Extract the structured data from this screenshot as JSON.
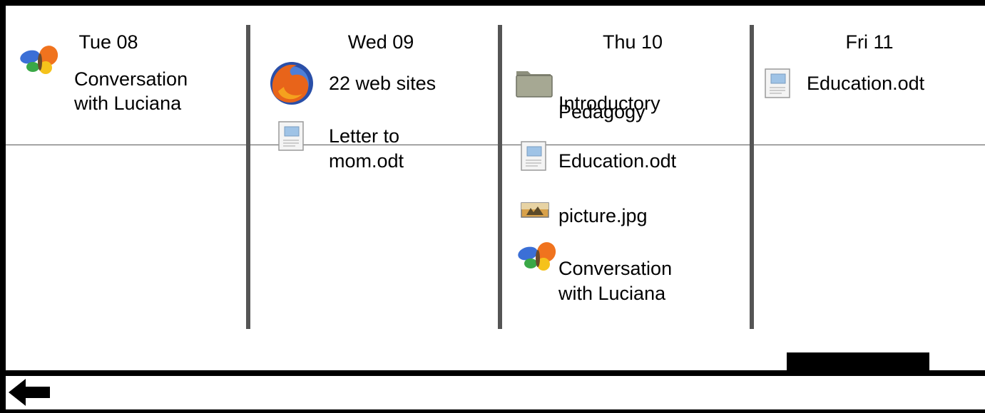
{
  "days": [
    {
      "header": "Tue 08",
      "items": [
        {
          "icon": "butterfly-chat-icon",
          "label_line1": "Conversation",
          "label_line2": "with Luciana"
        }
      ]
    },
    {
      "header": "Wed 09",
      "items": [
        {
          "icon": "firefox-icon",
          "label_line1": "22 web sites"
        },
        {
          "icon": "document-icon",
          "label_line1": "Letter to",
          "label_line2": "mom.odt"
        }
      ]
    },
    {
      "header": "Thu 10",
      "items": [
        {
          "icon": "folder-icon",
          "label_line1": "Introductory",
          "label_line2": "Pedagogy"
        },
        {
          "icon": "document-icon",
          "label_line1": "Education.odt"
        },
        {
          "icon": "image-icon",
          "label_line1": "picture.jpg"
        },
        {
          "icon": "butterfly-chat-icon",
          "label_line1": "Conversation",
          "label_line2": "with Luciana"
        }
      ]
    },
    {
      "header": "Fri 11",
      "items": [
        {
          "icon": "document-icon",
          "label_line1": "Education.odt"
        }
      ]
    }
  ],
  "navigation": {
    "back_icon": "left-arrow-icon"
  },
  "colors": {
    "background": "#000000",
    "panel": "#ffffff",
    "separator": "#555555"
  }
}
